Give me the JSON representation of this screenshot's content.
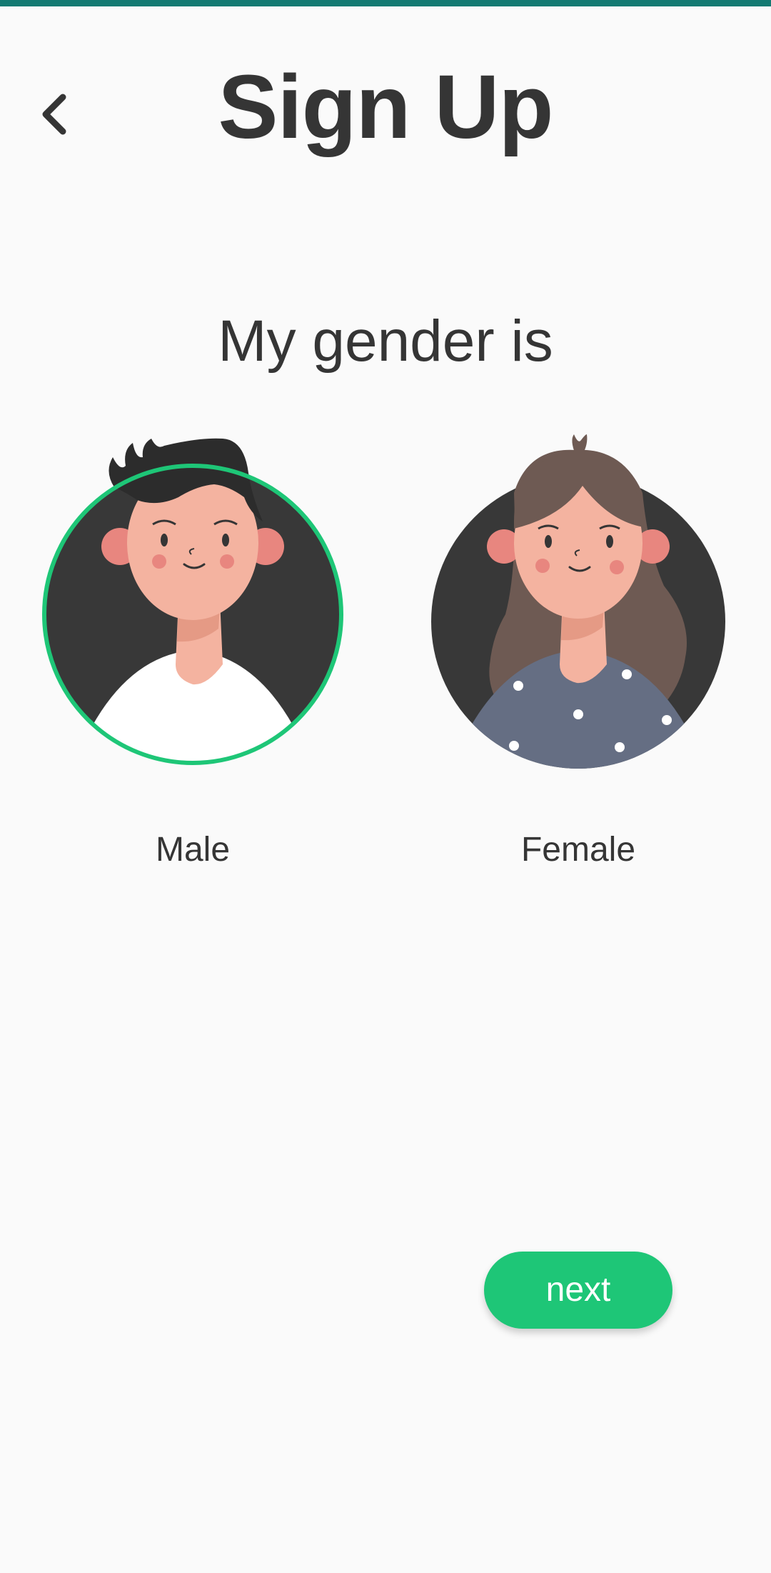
{
  "header": {
    "title": "Sign Up",
    "back_icon": "chevron-left-icon"
  },
  "prompt": "My gender is",
  "options": [
    {
      "label": "Male",
      "selected": true
    },
    {
      "label": "Female",
      "selected": false
    }
  ],
  "actions": {
    "next_label": "next"
  },
  "colors": {
    "accent": "#1ec677",
    "status_bar": "#137a72",
    "text": "#353535",
    "background": "#fafafa",
    "avatar_bg": "#383838"
  }
}
